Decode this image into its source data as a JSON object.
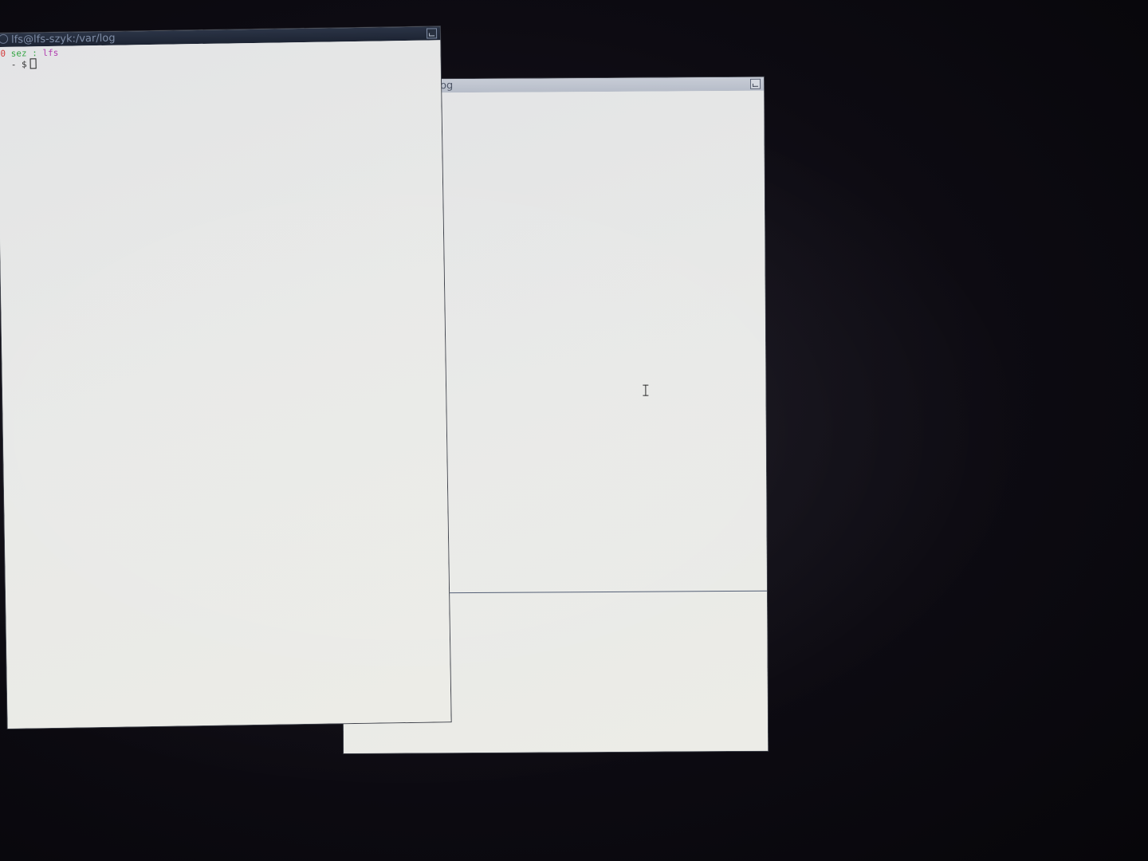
{
  "back_window": {
    "title": "/log"
  },
  "front_window": {
    "title": "lfs@lfs-szyk:/var/log",
    "terminal": {
      "prompt_status": "0",
      "prompt_user": "sez",
      "prompt_sep": ":",
      "prompt_host": "lfs",
      "prompt_dir": "-",
      "prompt_symbol": "$"
    }
  },
  "colors": {
    "titlebar_active": "#1d2433",
    "titlebar_inactive": "#b7bdc9",
    "window_bg": "#e6e7e5",
    "desktop_bg": "#0b0a10"
  }
}
